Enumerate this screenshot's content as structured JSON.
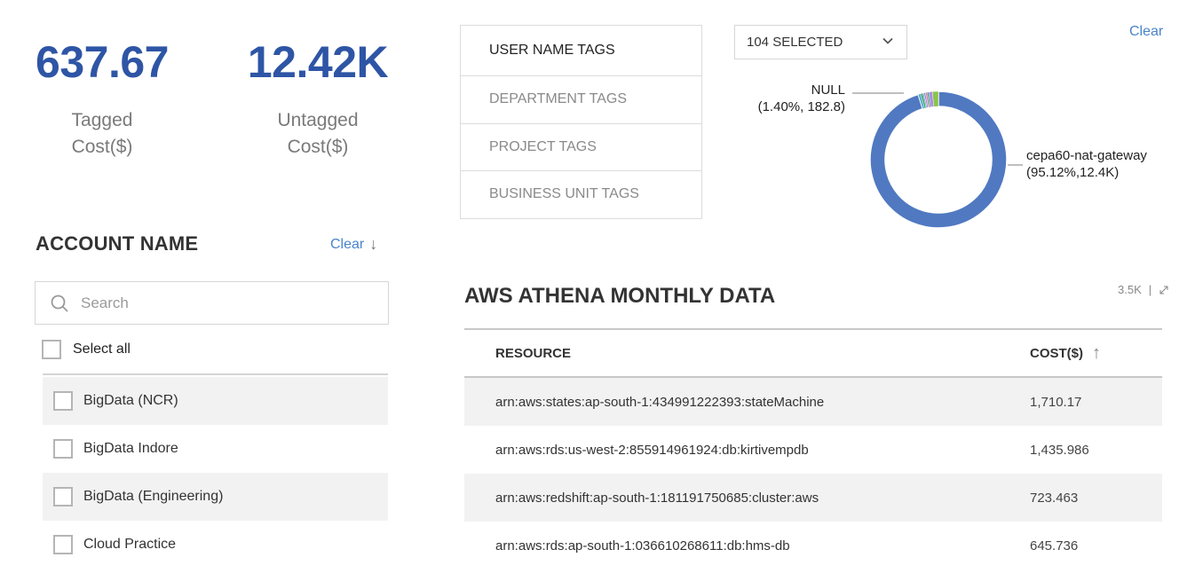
{
  "kpis": {
    "tagged": {
      "value": "637.67",
      "label_line1": "Tagged",
      "label_line2": "Cost($)"
    },
    "untagged": {
      "value": "12.42K",
      "label_line1": "Untagged",
      "label_line2": "Cost($)"
    }
  },
  "tag_tabs": [
    {
      "label": "USER NAME TAGS",
      "active": true
    },
    {
      "label": "DEPARTMENT TAGS",
      "active": false
    },
    {
      "label": "PROJECT TAGS",
      "active": false
    },
    {
      "label": "BUSINESS UNIT TAGS",
      "active": false
    }
  ],
  "tag_filter": {
    "dropdown_value": "104 SELECTED",
    "clear_label": "Clear"
  },
  "chart_data": {
    "type": "pie",
    "variant": "donut",
    "title": "",
    "slices": [
      {
        "label": "cepa60-nat-gateway",
        "percent": 95.12,
        "value": "12.4K",
        "color": "#5079c1",
        "annotation": "(95.12%,12.4K)"
      },
      {
        "label": "NULL",
        "percent": 1.4,
        "value": "182.8",
        "color": "#8bc34a",
        "annotation": "(1.40%, 182.8)"
      },
      {
        "label": "",
        "percent": 0.9,
        "color": "#a98ee6"
      },
      {
        "label": "",
        "percent": 0.35,
        "color": "#1aa36b"
      },
      {
        "label": "",
        "percent": 0.4,
        "color": "#e57aa8"
      },
      {
        "label": "",
        "percent": 0.35,
        "color": "#7c8fd6"
      },
      {
        "label": "",
        "percent": 0.3,
        "color": "#9b8ee0"
      },
      {
        "label": "",
        "percent": 0.5,
        "color": "#2fb25a"
      },
      {
        "label": "",
        "percent": 0.58,
        "color": "#5fa8d9"
      }
    ]
  },
  "account_filter": {
    "title": "ACCOUNT NAME",
    "clear_label": "Clear",
    "search_placeholder": "Search",
    "select_all_label": "Select all",
    "items": [
      {
        "label": "BigData (NCR)",
        "checked": false
      },
      {
        "label": "BigData Indore",
        "checked": false
      },
      {
        "label": "BigData (Engineering)",
        "checked": false
      },
      {
        "label": "Cloud Practice",
        "checked": false
      }
    ]
  },
  "table": {
    "title": "AWS ATHENA MONTHLY DATA",
    "total": "3.5K",
    "columns": {
      "resource": "RESOURCE",
      "cost": "COST($)"
    },
    "rows": [
      {
        "resource": "arn:aws:states:ap-south-1:434991222393:stateMachine",
        "cost": "1,710.17"
      },
      {
        "resource": "arn:aws:rds:us-west-2:855914961924:db:kirtivempdb",
        "cost": "1,435.986"
      },
      {
        "resource": "arn:aws:redshift:ap-south-1:181191750685:cluster:aws",
        "cost": "723.463"
      },
      {
        "resource": "arn:aws:rds:ap-south-1:036610268611:db:hms-db",
        "cost": "645.736"
      }
    ]
  }
}
